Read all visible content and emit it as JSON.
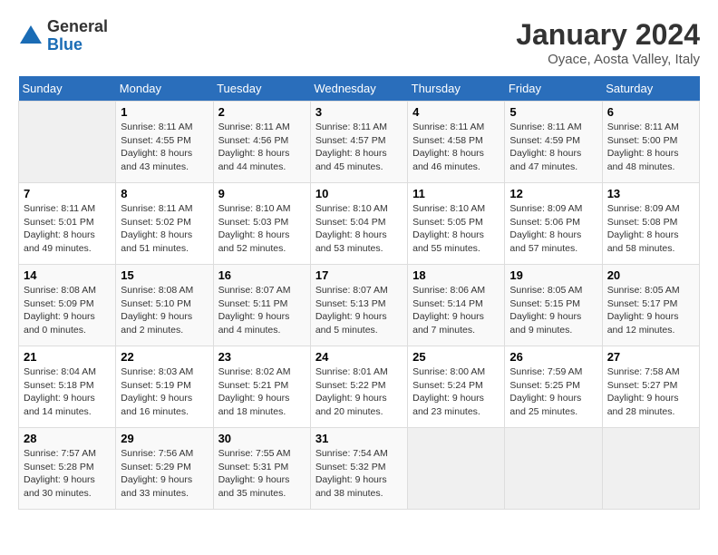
{
  "header": {
    "logo_general": "General",
    "logo_blue": "Blue",
    "month": "January 2024",
    "location": "Oyace, Aosta Valley, Italy"
  },
  "days_of_week": [
    "Sunday",
    "Monday",
    "Tuesday",
    "Wednesday",
    "Thursday",
    "Friday",
    "Saturday"
  ],
  "weeks": [
    [
      {
        "day": "",
        "info": ""
      },
      {
        "day": "1",
        "info": "Sunrise: 8:11 AM\nSunset: 4:55 PM\nDaylight: 8 hours\nand 43 minutes."
      },
      {
        "day": "2",
        "info": "Sunrise: 8:11 AM\nSunset: 4:56 PM\nDaylight: 8 hours\nand 44 minutes."
      },
      {
        "day": "3",
        "info": "Sunrise: 8:11 AM\nSunset: 4:57 PM\nDaylight: 8 hours\nand 45 minutes."
      },
      {
        "day": "4",
        "info": "Sunrise: 8:11 AM\nSunset: 4:58 PM\nDaylight: 8 hours\nand 46 minutes."
      },
      {
        "day": "5",
        "info": "Sunrise: 8:11 AM\nSunset: 4:59 PM\nDaylight: 8 hours\nand 47 minutes."
      },
      {
        "day": "6",
        "info": "Sunrise: 8:11 AM\nSunset: 5:00 PM\nDaylight: 8 hours\nand 48 minutes."
      }
    ],
    [
      {
        "day": "7",
        "info": "Sunrise: 8:11 AM\nSunset: 5:01 PM\nDaylight: 8 hours\nand 49 minutes."
      },
      {
        "day": "8",
        "info": "Sunrise: 8:11 AM\nSunset: 5:02 PM\nDaylight: 8 hours\nand 51 minutes."
      },
      {
        "day": "9",
        "info": "Sunrise: 8:10 AM\nSunset: 5:03 PM\nDaylight: 8 hours\nand 52 minutes."
      },
      {
        "day": "10",
        "info": "Sunrise: 8:10 AM\nSunset: 5:04 PM\nDaylight: 8 hours\nand 53 minutes."
      },
      {
        "day": "11",
        "info": "Sunrise: 8:10 AM\nSunset: 5:05 PM\nDaylight: 8 hours\nand 55 minutes."
      },
      {
        "day": "12",
        "info": "Sunrise: 8:09 AM\nSunset: 5:06 PM\nDaylight: 8 hours\nand 57 minutes."
      },
      {
        "day": "13",
        "info": "Sunrise: 8:09 AM\nSunset: 5:08 PM\nDaylight: 8 hours\nand 58 minutes."
      }
    ],
    [
      {
        "day": "14",
        "info": "Sunrise: 8:08 AM\nSunset: 5:09 PM\nDaylight: 9 hours\nand 0 minutes."
      },
      {
        "day": "15",
        "info": "Sunrise: 8:08 AM\nSunset: 5:10 PM\nDaylight: 9 hours\nand 2 minutes."
      },
      {
        "day": "16",
        "info": "Sunrise: 8:07 AM\nSunset: 5:11 PM\nDaylight: 9 hours\nand 4 minutes."
      },
      {
        "day": "17",
        "info": "Sunrise: 8:07 AM\nSunset: 5:13 PM\nDaylight: 9 hours\nand 5 minutes."
      },
      {
        "day": "18",
        "info": "Sunrise: 8:06 AM\nSunset: 5:14 PM\nDaylight: 9 hours\nand 7 minutes."
      },
      {
        "day": "19",
        "info": "Sunrise: 8:05 AM\nSunset: 5:15 PM\nDaylight: 9 hours\nand 9 minutes."
      },
      {
        "day": "20",
        "info": "Sunrise: 8:05 AM\nSunset: 5:17 PM\nDaylight: 9 hours\nand 12 minutes."
      }
    ],
    [
      {
        "day": "21",
        "info": "Sunrise: 8:04 AM\nSunset: 5:18 PM\nDaylight: 9 hours\nand 14 minutes."
      },
      {
        "day": "22",
        "info": "Sunrise: 8:03 AM\nSunset: 5:19 PM\nDaylight: 9 hours\nand 16 minutes."
      },
      {
        "day": "23",
        "info": "Sunrise: 8:02 AM\nSunset: 5:21 PM\nDaylight: 9 hours\nand 18 minutes."
      },
      {
        "day": "24",
        "info": "Sunrise: 8:01 AM\nSunset: 5:22 PM\nDaylight: 9 hours\nand 20 minutes."
      },
      {
        "day": "25",
        "info": "Sunrise: 8:00 AM\nSunset: 5:24 PM\nDaylight: 9 hours\nand 23 minutes."
      },
      {
        "day": "26",
        "info": "Sunrise: 7:59 AM\nSunset: 5:25 PM\nDaylight: 9 hours\nand 25 minutes."
      },
      {
        "day": "27",
        "info": "Sunrise: 7:58 AM\nSunset: 5:27 PM\nDaylight: 9 hours\nand 28 minutes."
      }
    ],
    [
      {
        "day": "28",
        "info": "Sunrise: 7:57 AM\nSunset: 5:28 PM\nDaylight: 9 hours\nand 30 minutes."
      },
      {
        "day": "29",
        "info": "Sunrise: 7:56 AM\nSunset: 5:29 PM\nDaylight: 9 hours\nand 33 minutes."
      },
      {
        "day": "30",
        "info": "Sunrise: 7:55 AM\nSunset: 5:31 PM\nDaylight: 9 hours\nand 35 minutes."
      },
      {
        "day": "31",
        "info": "Sunrise: 7:54 AM\nSunset: 5:32 PM\nDaylight: 9 hours\nand 38 minutes."
      },
      {
        "day": "",
        "info": ""
      },
      {
        "day": "",
        "info": ""
      },
      {
        "day": "",
        "info": ""
      }
    ]
  ]
}
